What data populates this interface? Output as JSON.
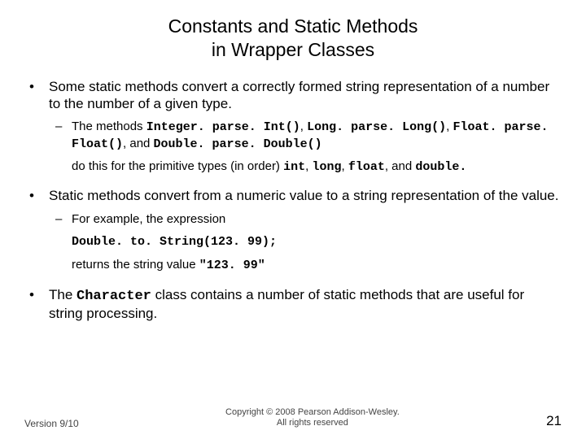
{
  "title_line1": "Constants and Static Methods",
  "title_line2": "in Wrapper Classes",
  "b1": {
    "text": "Some static methods convert a correctly formed string representation of a number to the number of a given type.",
    "sub_prefix": "The methods ",
    "code1": "Integer. parse. Int()",
    "sep1": ", ",
    "code2": "Long. parse. Long()",
    "sep2": ", ",
    "code3": "Float. parse. Float()",
    "sep3": ", and ",
    "code4": "Double. parse. Double()",
    "cont_prefix": "do this for the primitive types (in order) ",
    "t1": "int",
    "c1": ", ",
    "t2": "long",
    "c2": ", ",
    "t3": "float",
    "c3": ", and ",
    "t4": "double.",
    "t4_trail": ""
  },
  "b2": {
    "text": "Static methods convert from a numeric value to a string representation of the value.",
    "sub": "For example, the expression",
    "code": "Double. to. String(123. 99);",
    "ret_prefix": "returns the string value ",
    "ret_code": "\"123. 99\""
  },
  "b3": {
    "prefix": "The ",
    "code": "Character",
    "suffix": " class contains a number of static methods that are useful for string processing."
  },
  "footer": {
    "version": "Version 9/10",
    "copyright_line1": "Copyright © 2008 Pearson Addison-Wesley.",
    "copyright_line2": "All rights reserved",
    "page": "21"
  }
}
